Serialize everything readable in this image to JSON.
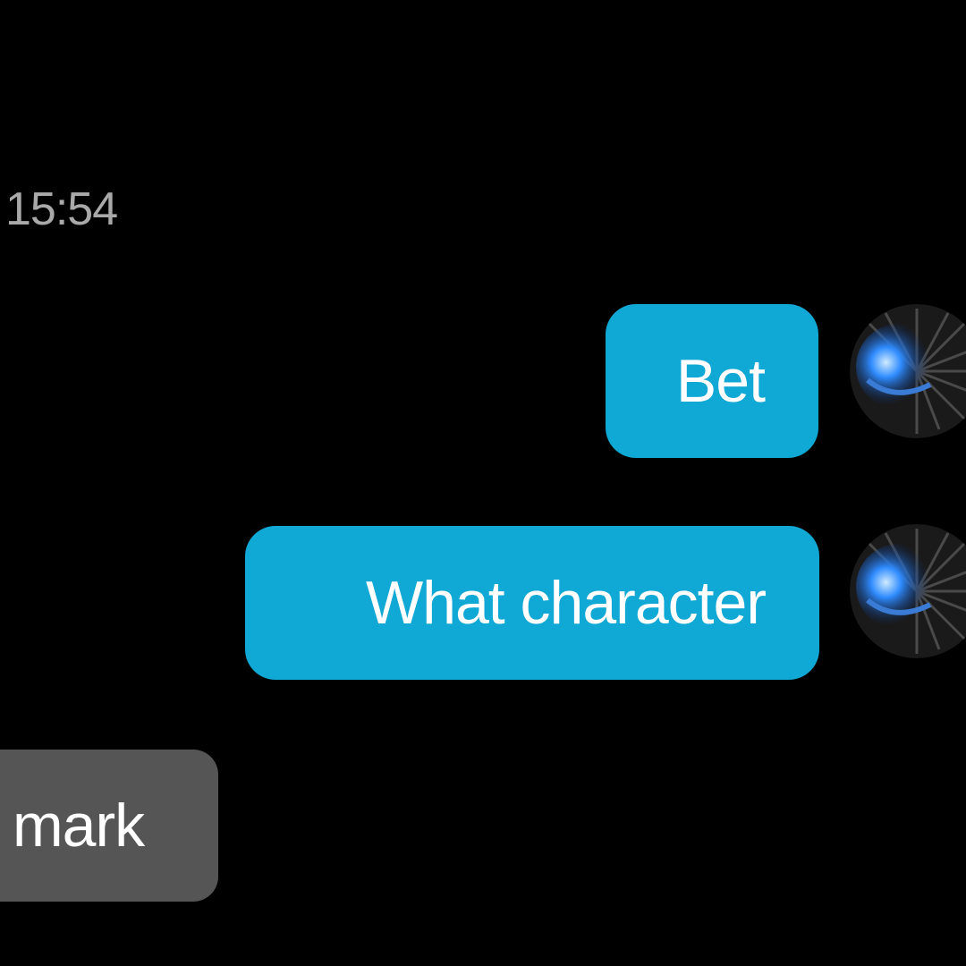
{
  "conversation": {
    "timestamp": "15:54",
    "messages": [
      {
        "sender": "me",
        "text": "Bet",
        "avatar_icon": "blue-swirl-avatar-icon"
      },
      {
        "sender": "me",
        "text": "What character",
        "avatar_icon": "blue-swirl-avatar-icon"
      },
      {
        "sender": "other",
        "text": "mark"
      }
    ]
  },
  "colors": {
    "background": "#000000",
    "outgoing_bubble": "#10a8d4",
    "incoming_bubble": "#555555",
    "timestamp_text": "#a9a9a9",
    "bubble_text": "#ffffff"
  }
}
